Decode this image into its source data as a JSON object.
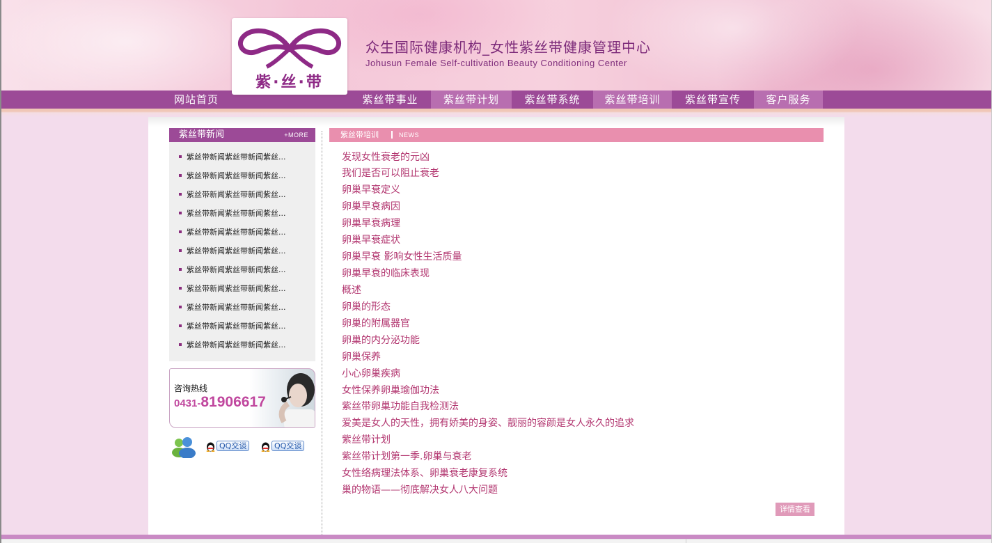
{
  "header": {
    "logo_text": "紫·丝·带",
    "title": "众生国际健康机构_女性紫丝带健康管理中心",
    "subtitle": "Johusun Female Self-cultivation Beauty Conditioning Center"
  },
  "nav": {
    "items": [
      {
        "label": "网站首页"
      },
      {
        "label": "紫丝带事业"
      },
      {
        "label": "紫丝带计划"
      },
      {
        "label": "紫丝带系统"
      },
      {
        "label": "紫丝带培训"
      },
      {
        "label": "紫丝带宣传"
      },
      {
        "label": "客户服务"
      }
    ]
  },
  "news": {
    "title": "紫丝带新闻",
    "more": "+MORE",
    "items": [
      "紫丝带新闻紫丝带新闻紫丝...",
      "紫丝带新闻紫丝带新闻紫丝...",
      "紫丝带新闻紫丝带新闻紫丝...",
      "紫丝带新闻紫丝带新闻紫丝...",
      "紫丝带新闻紫丝带新闻紫丝...",
      "紫丝带新闻紫丝带新闻紫丝...",
      "紫丝带新闻紫丝带新闻紫丝...",
      "紫丝带新闻紫丝带新闻紫丝...",
      "紫丝带新闻紫丝带新闻紫丝...",
      "紫丝带新闻紫丝带新闻紫丝...",
      "紫丝带新闻紫丝带新闻紫丝..."
    ]
  },
  "hotline": {
    "label": "咨询热线",
    "area_code": "0431-",
    "number": "81906617"
  },
  "qq": {
    "chat_label_1": "QQ交谈",
    "chat_label_2": "QQ交谈"
  },
  "training": {
    "title": "紫丝带培训",
    "tag": "NEWS",
    "links": [
      "发现女性衰老的元凶",
      "我们是否可以阻止衰老",
      "卵巢早衰定义",
      "卵巢早衰病因",
      "卵巢早衰病理",
      "卵巢早衰症状",
      "卵巢早衰 影响女性生活质量",
      "卵巢早衰的临床表现",
      "概述",
      "卵巢的形态",
      "卵巢的附属器官",
      "卵巢的内分泌功能",
      "卵巢保养",
      "小心卵巢疾病",
      "女性保养卵巢瑜伽功法",
      "紫丝带卵巢功能自我检测法",
      "爱美是女人的天性，拥有娇美的身姿、靓丽的容颜是女人永久的追求",
      "紫丝带计划",
      "紫丝带计划第一季.卵巢与衰老",
      "女性络病理法体系、卵巢衰老康复系统",
      "巢的物语——彻底解决女人八大问题"
    ],
    "detail_button": "详情查看"
  },
  "colors": {
    "brand_purple": "#9c4a97",
    "nav_highlight": "#b86eb0",
    "pink_header": "#e98fae",
    "link_color": "#b2356f",
    "page_bg": "#f3dcec"
  }
}
